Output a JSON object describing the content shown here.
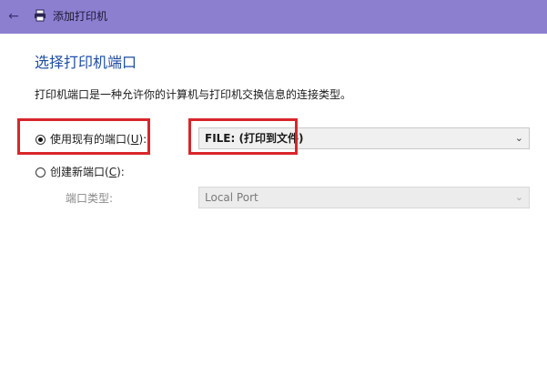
{
  "window": {
    "title": "添加打印机",
    "back_icon": "arrow-left-icon",
    "title_icon": "printer-icon",
    "titlebar_color": "#8c7fd0"
  },
  "page": {
    "heading": "选择打印机端口",
    "description": "打印机端口是一种允许你的计算机与打印机交换信息的连接类型。"
  },
  "existing_port": {
    "label": "使用现有的端口(U):",
    "label_prefix": "使用现有的端口(",
    "hotkey": "U",
    "label_suffix": "):",
    "selected": true,
    "dropdown_value": "FILE: (打印到文件)"
  },
  "new_port": {
    "label": "创建新端口(C):",
    "label_prefix": "创建新端口(",
    "hotkey": "C",
    "label_suffix": "):",
    "selected": false,
    "type_label": "端口类型:",
    "type_value": "Local Port"
  },
  "highlight_color": "#d8262b"
}
